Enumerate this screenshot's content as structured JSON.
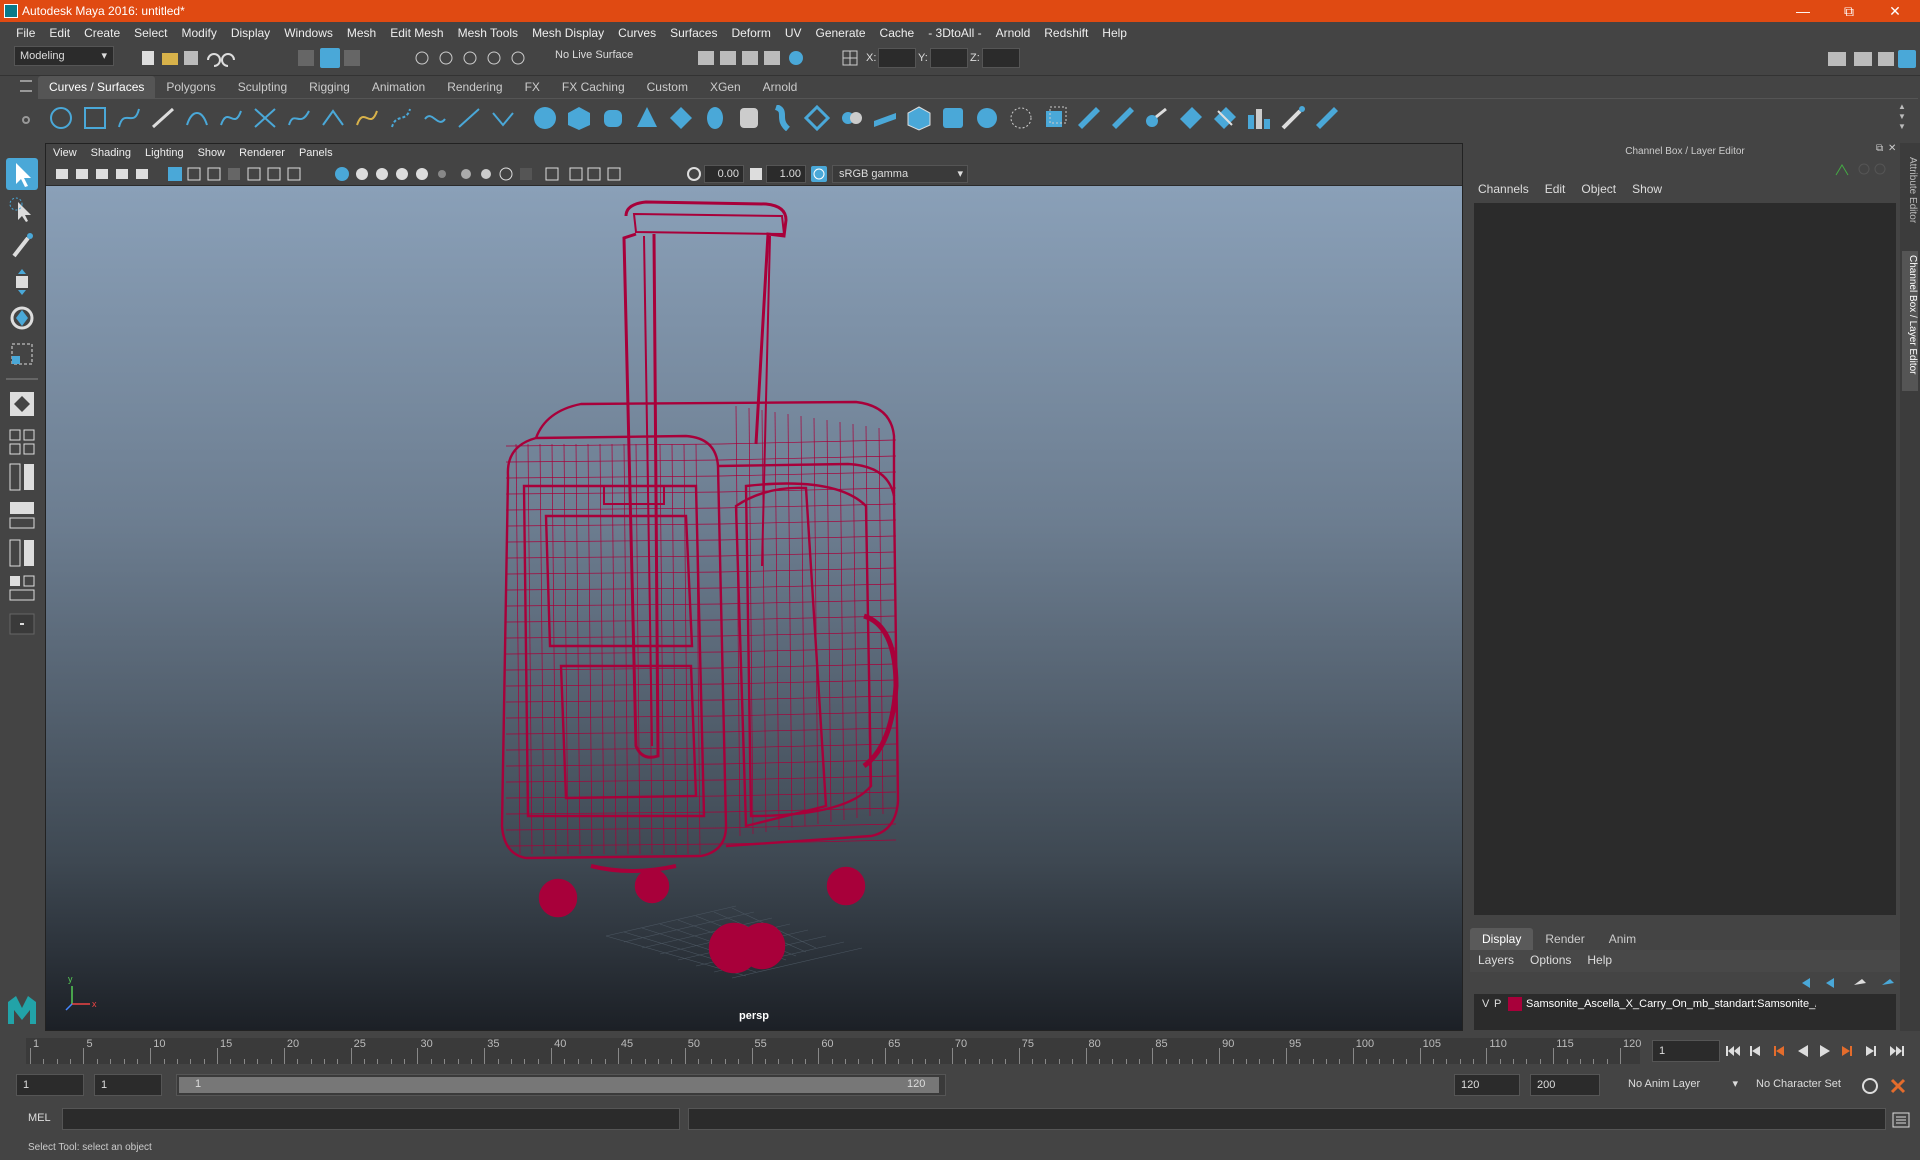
{
  "window": {
    "title": "Autodesk Maya 2016: untitled*"
  },
  "menubar": [
    "File",
    "Edit",
    "Create",
    "Select",
    "Modify",
    "Display",
    "Windows",
    "Mesh",
    "Edit Mesh",
    "Mesh Tools",
    "Mesh Display",
    "Curves",
    "Surfaces",
    "Deform",
    "UV",
    "Generate",
    "Cache",
    "- 3DtoAll -",
    "Arnold",
    "Redshift",
    "Help"
  ],
  "statusline": {
    "mode": "Modeling",
    "live_surface": "No Live Surface",
    "x_label": "X:",
    "y_label": "Y:",
    "z_label": "Z:"
  },
  "shelf": {
    "tabs": [
      "Curves / Surfaces",
      "Polygons",
      "Sculpting",
      "Rigging",
      "Animation",
      "Rendering",
      "FX",
      "FX Caching",
      "Custom",
      "XGen",
      "Arnold"
    ],
    "active": "Curves / Surfaces"
  },
  "viewport": {
    "menus": [
      "View",
      "Shading",
      "Lighting",
      "Show",
      "Renderer",
      "Panels"
    ],
    "exposure": "0.00",
    "gamma": "1.00",
    "color_space": "sRGB gamma",
    "camera": "persp",
    "wire_color": "#a8003a"
  },
  "right_panel": {
    "title": "Channel Box / Layer Editor",
    "channel_menus": [
      "Channels",
      "Edit",
      "Object",
      "Show"
    ],
    "layer_tabs": [
      "Display",
      "Render",
      "Anim"
    ],
    "layer_active": "Display",
    "layer_menus": [
      "Layers",
      "Options",
      "Help"
    ],
    "layers": [
      {
        "v": "V",
        "p": "P",
        "name": "Samsonite_Ascella_X_Carry_On_mb_standart:Samsonite_/",
        "color": "#a8003a"
      }
    ]
  },
  "side_tabs": [
    "Attribute Editor",
    "Channel Box / Layer Editor"
  ],
  "timeline": {
    "labels": [
      "1",
      "5",
      "10",
      "15",
      "20",
      "25",
      "30",
      "35",
      "40",
      "45",
      "50",
      "55",
      "60",
      "65",
      "70",
      "75",
      "80",
      "85",
      "90",
      "95",
      "100",
      "105",
      "110",
      "115",
      "120"
    ],
    "current_frame": "1"
  },
  "range": {
    "start": "1",
    "anim_start": "1",
    "slider_start": "1",
    "slider_end": "120",
    "end": "120",
    "anim_end": "200",
    "anim_layer": "No Anim Layer",
    "character_set": "No Character Set"
  },
  "command": {
    "lang": "MEL"
  },
  "help_line": "Select Tool: select an object"
}
